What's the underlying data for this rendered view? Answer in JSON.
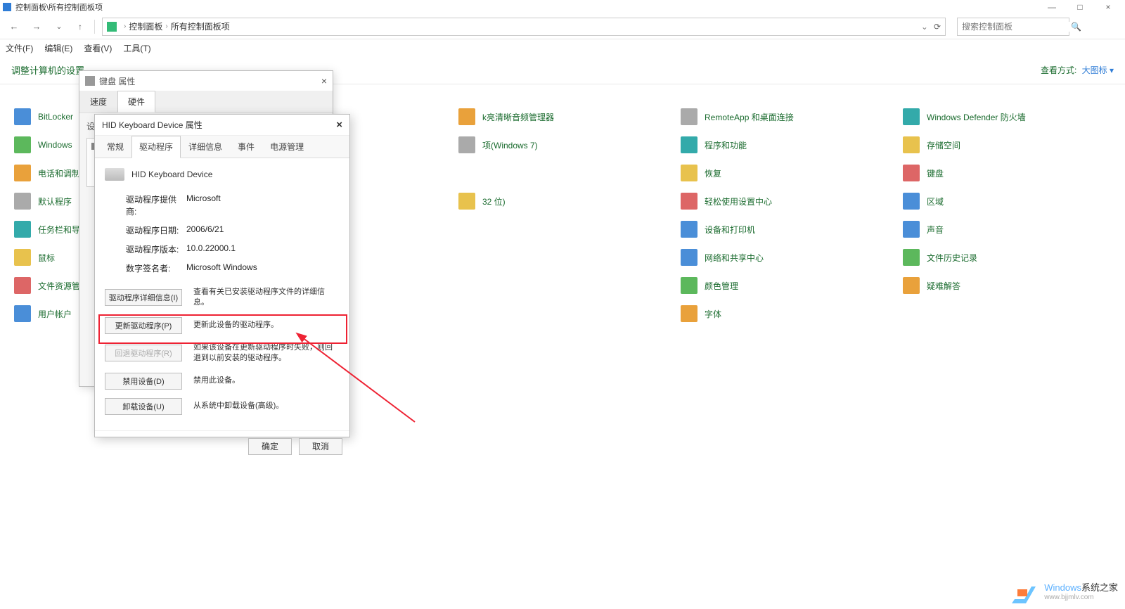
{
  "window": {
    "title": "控制面板\\所有控制面板项",
    "minimize": "—",
    "maximize": "□",
    "close": "×"
  },
  "nav": {
    "back": "←",
    "forward": "→",
    "up": "↑",
    "refresh": "⟳",
    "dropdown": "⌄",
    "breadcrumb": {
      "part1": "控制面板",
      "part2": "所有控制面板项"
    },
    "search_placeholder": "搜索控制面板"
  },
  "menu": {
    "file": "文件(F)",
    "edit": "编辑(E)",
    "view": "查看(V)",
    "tools": "工具(T)"
  },
  "content": {
    "heading": "调整计算机的设置",
    "view_by_label": "查看方式:",
    "view_by_value": "大图标 ▾"
  },
  "items": {
    "c0": [
      "BitLocker",
      "Windows",
      "电话和调制",
      "默认程序",
      "任务栏和导",
      "鼠标",
      "文件资源管",
      "用户帐户"
    ],
    "c2": [
      "k亮清晰音频管理器",
      "项(Windows 7)",
      "",
      "32 位)",
      "",
      "",
      "",
      ""
    ],
    "c3": [
      "RemoteApp 和桌面连接",
      "程序和功能",
      "恢复",
      "轻松使用设置中心",
      "设备和打印机",
      "网络和共享中心",
      "颜色管理",
      "字体"
    ],
    "c4": [
      "Windows Defender 防火墙",
      "存储空间",
      "键盘",
      "区域",
      "声音",
      "文件历史记录",
      "疑难解答",
      ""
    ]
  },
  "dialog1": {
    "title": "键盘 属性",
    "tab_speed": "速度",
    "tab_hardware": "硬件",
    "devices_label": "设",
    "device_item": "HID Keyboard Device"
  },
  "dialog2": {
    "title": "HID Keyboard Device 属性",
    "close": "×",
    "tabs": {
      "general": "常规",
      "driver": "驱动程序",
      "details": "详细信息",
      "events": "事件",
      "power": "电源管理"
    },
    "device_name": "HID Keyboard Device",
    "info": {
      "provider_label": "驱动程序提供商:",
      "provider_value": "Microsoft",
      "date_label": "驱动程序日期:",
      "date_value": "2006/6/21",
      "version_label": "驱动程序版本:",
      "version_value": "10.0.22000.1",
      "signer_label": "数字签名者:",
      "signer_value": "Microsoft Windows"
    },
    "actions": {
      "details_btn": "驱动程序详细信息(I)",
      "details_desc": "查看有关已安装驱动程序文件的详细信息。",
      "update_btn": "更新驱动程序(P)",
      "update_desc": "更新此设备的驱动程序。",
      "rollback_btn": "回退驱动程序(R)",
      "rollback_desc": "如果该设备在更新驱动程序时失败，则回退到以前安装的驱动程序。",
      "disable_btn": "禁用设备(D)",
      "disable_desc": "禁用此设备。",
      "uninstall_btn": "卸载设备(U)",
      "uninstall_desc": "从系统中卸载设备(高级)。"
    },
    "footer": {
      "ok": "确定",
      "cancel": "取消"
    }
  },
  "watermark": {
    "brand": "Windows",
    "suffix": "系统之家",
    "url": "www.bjjmlv.com"
  }
}
